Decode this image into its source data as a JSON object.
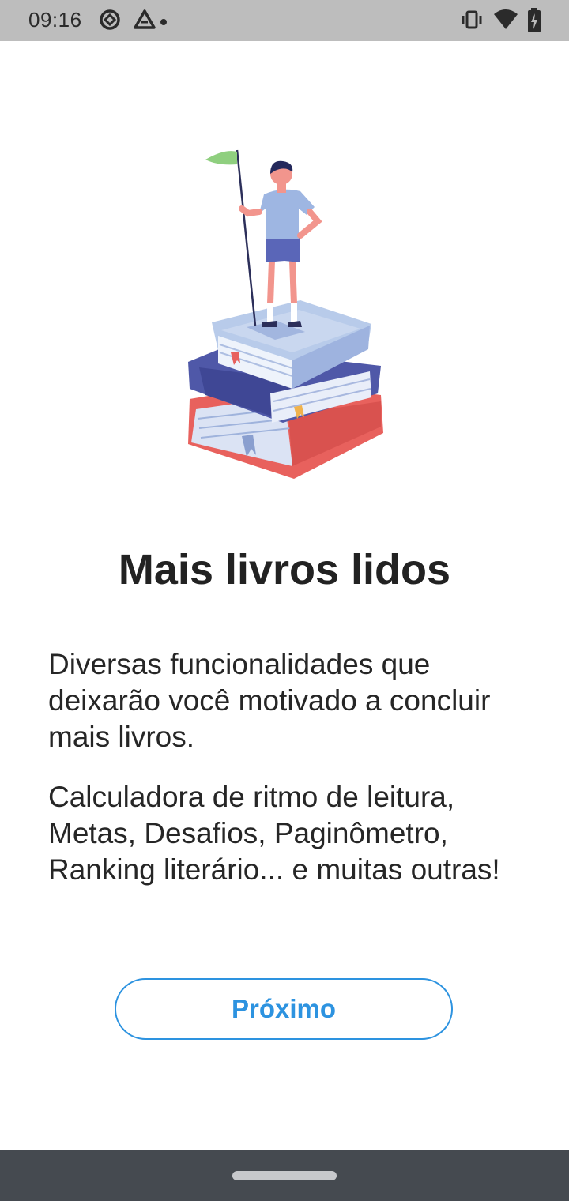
{
  "status_bar": {
    "time": "09:16",
    "left_icons": [
      "sync-icon",
      "drive-icon",
      "notification-dot-icon"
    ],
    "right_icons": [
      "vibrate-icon",
      "wifi-icon",
      "battery-charging-icon"
    ]
  },
  "onboarding": {
    "illustration": "person-with-flag-on-books",
    "title": "Mais livros lidos",
    "paragraph_1": "Diversas funcionalidades que deixarão você motivado a concluir mais livros.",
    "paragraph_2": "Calculadora de ritmo de leitura, Metas, Desafios, Paginômetro, Ranking literário... e muitas outras!",
    "next_button_label": "Próximo"
  },
  "colors": {
    "accent": "#2d93e0",
    "status_bar_bg": "#bdbdbd",
    "nav_bar_bg": "#454a50"
  }
}
